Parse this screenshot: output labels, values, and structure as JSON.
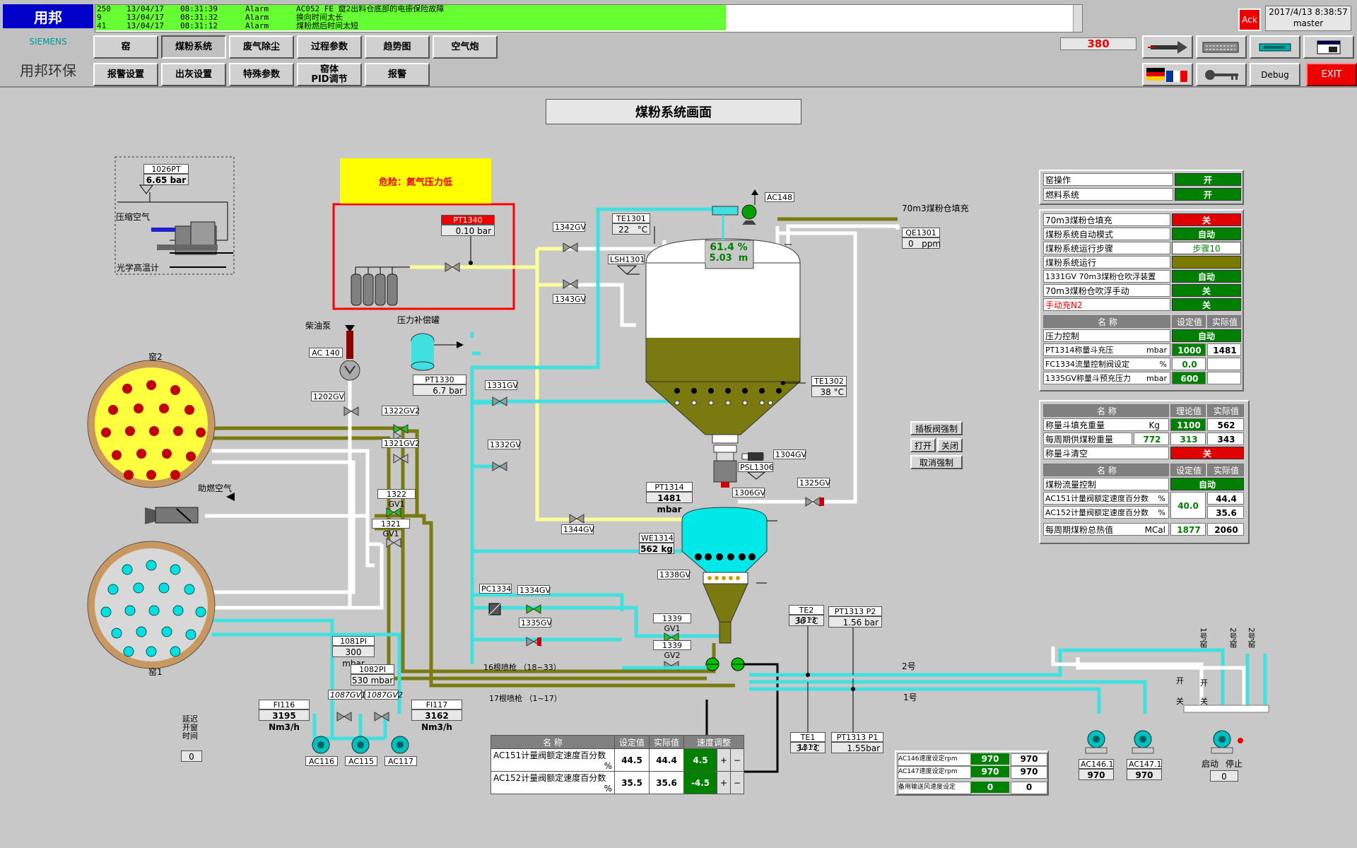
{
  "header": {
    "logo_top": "用邦",
    "brand": "SIEMENS",
    "logo_bottom": "用邦环保",
    "ack_label": "Ack",
    "date": "2017/4/13 8:38:57",
    "user": "master",
    "counter": "380",
    "debug_label": "Debug",
    "exit_label": "EXIT",
    "nav_row1": [
      "窑",
      "煤粉系统",
      "废气除尘",
      "过程参数",
      "趋势图",
      "空气炮"
    ],
    "nav_row2": [
      "报警设置",
      "出灰设置",
      "特殊参数",
      "窑体\nPID调节",
      "报警"
    ]
  },
  "alarms": [
    {
      "id": "250",
      "date": "13/04/17",
      "time": "08:31:39",
      "type": "Alarm",
      "text": "AC052 FE 窟2出料仓底部的电振保险故障"
    },
    {
      "id": "9",
      "date": "13/04/17",
      "time": "08:31:32",
      "type": "Alarm",
      "text": "换向时间太长"
    },
    {
      "id": "41",
      "date": "13/04/17",
      "time": "08:31:12",
      "type": "Alarm",
      "text": "煤粉燃后时间太短"
    }
  ],
  "page_title": "煤粉系统画面",
  "warning": "危险：氮气压力低",
  "tags": {
    "pt1026": {
      "name": "1026PT",
      "value": "6.65 bar"
    },
    "compressed_air": "压缩空气",
    "optical_pyro": "光学高温计",
    "pt1340": {
      "name": "PT1340",
      "value": "0.10 bar"
    },
    "diesel_pump": "柴油泵",
    "ac140": "AC 140",
    "gv1202": "1202GV",
    "pressure_tank": "压力补偿罐",
    "pt1330": {
      "name": "PT1330",
      "value": "6.7 bar"
    },
    "kiln2": "窑2",
    "kiln1": "窑1",
    "combustion_air": "助燃空气",
    "gv1342": "1342GV",
    "gv1343": "1343GV",
    "te1301": {
      "name": "TE1301",
      "value": "22",
      "unit": "°C"
    },
    "lsh1301": "LSH1301",
    "level_pct": "61.4 %",
    "level_m": "5.03",
    "level_unit": "m",
    "ac148": "AC148",
    "fill_70": "70m3煤粉仓填充",
    "qe1301": {
      "name": "QE1301",
      "value": "0",
      "unit": "ppm"
    },
    "te1302": {
      "name": "TE1302",
      "value": "38",
      "unit": "°C"
    },
    "gv1322_2": "1322GV2",
    "gv1321_2": "1321GV2",
    "gv1331": "1331GV",
    "gv1332": "1332GV",
    "gv1322_1": "1322 GV1",
    "gv1321_1": "1321 GV1",
    "gv1344": "1344GV",
    "gv1304": "1304GV",
    "psl1306": "PSL1306",
    "gv1306": "1306GV",
    "gv1325": "1325GV",
    "pt1314": {
      "name": "PT1314",
      "value": "1481 mbar"
    },
    "we1314": {
      "name": "WE1314",
      "value": "562",
      "unit": "kg"
    },
    "gv1338": "1338GV",
    "pc1334": "PC1334",
    "gv1334": "1334GV",
    "gv1335": "1335GV",
    "gv1339_1": "1339 GV1",
    "gv1339_2": "1339 GV2",
    "lance16": "16根喷枪 （18~33）",
    "lance17": "17根喷枪 （1~17）",
    "te1313_2": {
      "name": "TE2 1313",
      "value": "36",
      "unit": "°C"
    },
    "pt1313_2": {
      "name": "PT1313 P2",
      "value": "1.56 bar"
    },
    "te1313_1": {
      "name": "TE1 1313",
      "value": "34",
      "unit": "°C"
    },
    "pt1313_1": {
      "name": "PT1313 P1",
      "value": "1.55bar"
    },
    "line2": "2号",
    "line1": "1号",
    "pi1081": {
      "name": "1081PI",
      "value": "300 mbar"
    },
    "pi1082": {
      "name": "1082PI",
      "value": "530 mbar"
    },
    "gv1087_1": "1087GV1",
    "gv1087_2": "1087GV2",
    "fi116": {
      "name": "FI116",
      "value": "3195 Nm3/h"
    },
    "fi117": {
      "name": "FI117",
      "value": "3162 Nm3/h"
    },
    "ac116": "AC116",
    "ac115": "AC115",
    "ac117": "AC117",
    "delay": "延迟\n开窗\n时间",
    "delay_value": "0",
    "ac146": {
      "name": "AC146.1",
      "value": "970"
    },
    "ac147": {
      "name": "AC147.1",
      "value": "970"
    },
    "start": "启动",
    "stop": "停止",
    "start_value": "0",
    "kiln1_vert": "1号窑",
    "kiln2_vert1": "2号窑",
    "kiln2_vert2": "2号窑",
    "open": "开",
    "close": "关"
  },
  "valve_control": {
    "force": "插板阀强制",
    "open": "打开",
    "close": "关闭",
    "cancel": "取消强制"
  },
  "panel1": [
    {
      "label": "窑操作",
      "status": "开",
      "color": "g"
    },
    {
      "label": "燃料系统",
      "status": "开",
      "color": "g"
    }
  ],
  "panel2": [
    {
      "label": "70m3煤粉仓填充",
      "status": "关",
      "color": "r"
    },
    {
      "label": "煤粉系统自动模式",
      "status": "自动",
      "color": "g"
    },
    {
      "label": "煤粉系统运行步骤",
      "status": "步骤10",
      "color": "w"
    },
    {
      "label": "煤粉系统运行",
      "status": "",
      "color": "o"
    },
    {
      "label": "1331GV 70m3煤粉仓吹浮装置",
      "status": "自动",
      "color": "g"
    },
    {
      "label": "70m3煤粉仓吹浮手动",
      "status": "关",
      "color": "g"
    },
    {
      "label": "手动充N2",
      "status": "关",
      "color": "g",
      "red_label": true
    }
  ],
  "panel2_table": {
    "header": [
      "名 称",
      "设定值",
      "实际值"
    ],
    "pressure_control": {
      "label": "压力控制",
      "status": "自动"
    },
    "rows": [
      {
        "label": "PT1314称量斗充压",
        "unit": "mbar",
        "set": "1000",
        "actual": "1481"
      },
      {
        "label": "FC1334流量控制阀设定",
        "unit": "%",
        "set": "0.0",
        "actual": ""
      },
      {
        "label": "1335GV称量斗预充压力",
        "unit": "mbar",
        "set": "600",
        "actual": ""
      }
    ]
  },
  "panel3": {
    "header": [
      "名 称",
      "理论值",
      "实际值"
    ],
    "fill_weight": {
      "label": "称量斗填充重量",
      "unit": "Kg",
      "theory": "1100",
      "actual": "562"
    },
    "per_cycle": {
      "label": "每周期供煤粉重量",
      "extra": "772",
      "theory": "313",
      "actual": "343"
    },
    "empty": {
      "label": "称量斗清空",
      "status": "关"
    },
    "header2": [
      "名 称",
      "设定值",
      "实际值"
    ],
    "flow_control": {
      "label": "煤粉流量控制",
      "status": "自动"
    },
    "ac151": {
      "label": "AC151计量阀额定速度百分数",
      "unit": "%",
      "actual": "44.4"
    },
    "ac152": {
      "label": "AC152计量阀额定速度百分数",
      "unit": "%",
      "actual": "35.6"
    },
    "shared_set": "40.0",
    "heat": {
      "label": "每周期煤粉总热值",
      "unit": "MCal",
      "set": "1877",
      "actual": "2060"
    }
  },
  "bottom_table": {
    "header": [
      "名 称",
      "设定值",
      "实际值",
      "速度调整"
    ],
    "rows": [
      {
        "label": "AC151计量阀额定速度百分数",
        "unit": "%",
        "set": "44.5",
        "actual": "44.4",
        "adj": "4.5"
      },
      {
        "label": "AC152计量阀额定速度百分数",
        "unit": "%",
        "set": "35.5",
        "actual": "35.6",
        "adj": "-4.5"
      }
    ],
    "plus": "+",
    "minus": "−"
  },
  "speed_table": {
    "rows": [
      {
        "label": "AC146速度设定rpm",
        "set": "970",
        "actual": "970"
      },
      {
        "label": "AC147速度设定rpm",
        "set": "970",
        "actual": "970"
      }
    ],
    "backup": {
      "label": "备用输送风速度设定",
      "set": "0",
      "actual": "0"
    }
  },
  "colors": {
    "pipe_air": "#ffffff",
    "pipe_water": "#40e0e0",
    "pipe_coal": "#7a7a10",
    "pipe_gas": "#ffff99",
    "alarm_bg": "#66ff33",
    "warning_bg": "#ffff00"
  }
}
